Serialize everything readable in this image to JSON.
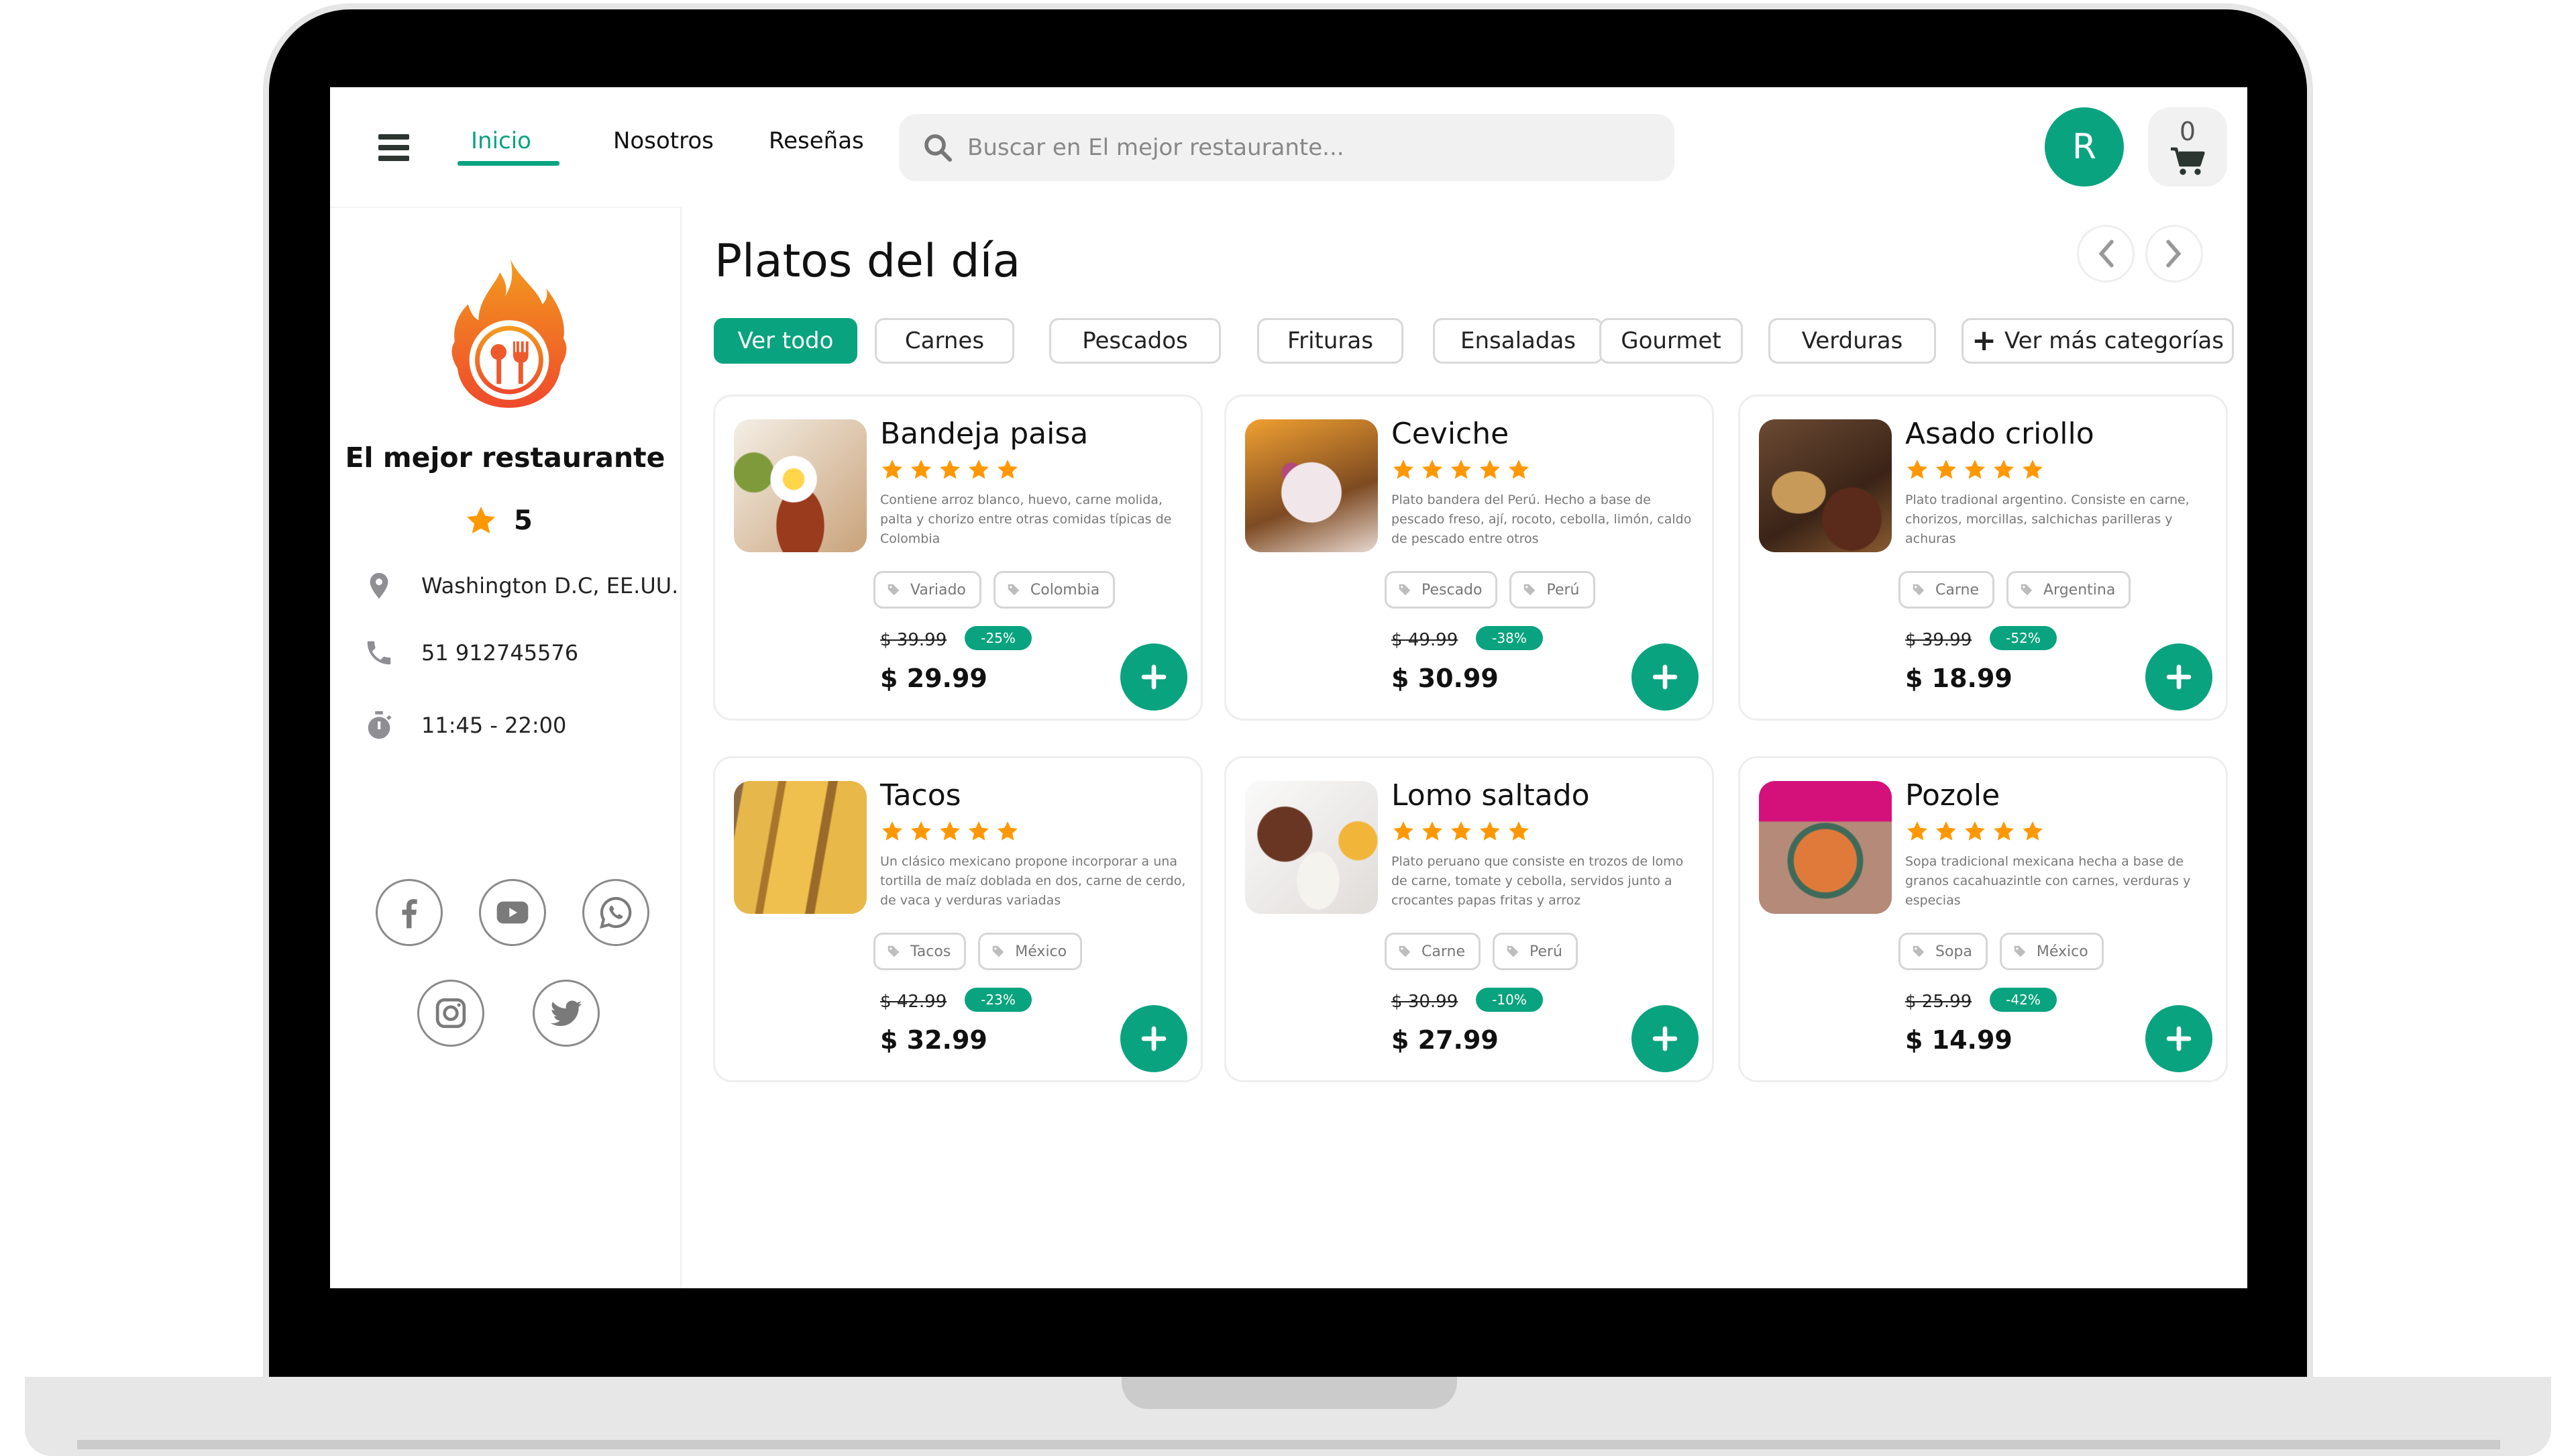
{
  "header": {
    "nav": [
      {
        "label": "Inicio",
        "active": true
      },
      {
        "label": "Nosotros",
        "active": false
      },
      {
        "label": "Reseñas",
        "active": false
      }
    ],
    "search_placeholder": "Buscar en El mejor restaurante...",
    "avatar_initial": "R",
    "cart_count": "0"
  },
  "sidebar": {
    "restaurant_name": "El mejor restaurante",
    "rating": "5",
    "address": "Washington D.C, EE.UU.",
    "phone": "51 912745576",
    "hours": "11:45 - 22:00",
    "socials": [
      "facebook",
      "youtube",
      "whatsapp",
      "instagram",
      "twitter"
    ]
  },
  "main": {
    "title": "Platos del día",
    "categories": [
      "Ver todo",
      "Carnes",
      "Pescados",
      "Frituras",
      "Ensaladas",
      "Gourmet",
      "Verduras"
    ],
    "active_category": "Ver todo",
    "more_categories_label": "Ver más categorías",
    "dishes": [
      {
        "name": "Bandeja paisa",
        "rating": 5,
        "description": "Contiene arroz blanco, huevo, carne molida, palta y chorizo entre otras comidas típicas de Colombia",
        "tags": [
          "Variado",
          "Colombia"
        ],
        "old_price": "$ 39.99",
        "discount": "-25%",
        "price": "$ 29.99"
      },
      {
        "name": "Ceviche",
        "rating": 5,
        "description": "Plato bandera del Perú. Hecho a base de pescado freso, ají, rocoto, cebolla, limón, caldo de pescado entre otros",
        "tags": [
          "Pescado",
          "Perú"
        ],
        "old_price": "$ 49.99",
        "discount": "-38%",
        "price": "$ 30.99"
      },
      {
        "name": "Asado criollo",
        "rating": 5,
        "description": "Plato tradional argentino. Consiste en carne, chorizos, morcillas, salchichas parilleras y achuras",
        "tags": [
          "Carne",
          "Argentina"
        ],
        "old_price": "$ 39.99",
        "discount": "-52%",
        "price": "$ 18.99"
      },
      {
        "name": "Tacos",
        "rating": 5,
        "description": "Un clásico mexicano propone incorporar a una tortilla de maíz doblada en dos, carne de cerdo, de vaca y verduras variadas",
        "tags": [
          "Tacos",
          "México"
        ],
        "old_price": "$ 42.99",
        "discount": "-23%",
        "price": "$ 32.99"
      },
      {
        "name": "Lomo saltado",
        "rating": 5,
        "description": "Plato peruano que consiste en trozos de lomo de carne, tomate y cebolla, servidos junto a crocantes papas fritas y arroz",
        "tags": [
          "Carne",
          "Perú"
        ],
        "old_price": "$ 30.99",
        "discount": "-10%",
        "price": "$ 27.99"
      },
      {
        "name": "Pozole",
        "rating": 5,
        "description": "Sopa tradicional mexicana hecha a base de granos cacahuazintle con carnes, verduras y especias",
        "tags": [
          "Sopa",
          "México"
        ],
        "old_price": "$ 25.99",
        "discount": "-42%",
        "price": "$ 14.99"
      }
    ]
  },
  "colors": {
    "accent": "#0aa37f",
    "star": "#ff9800",
    "logo_flame_top": "#f39a1e",
    "logo_flame_bottom": "#ee4a2c"
  }
}
